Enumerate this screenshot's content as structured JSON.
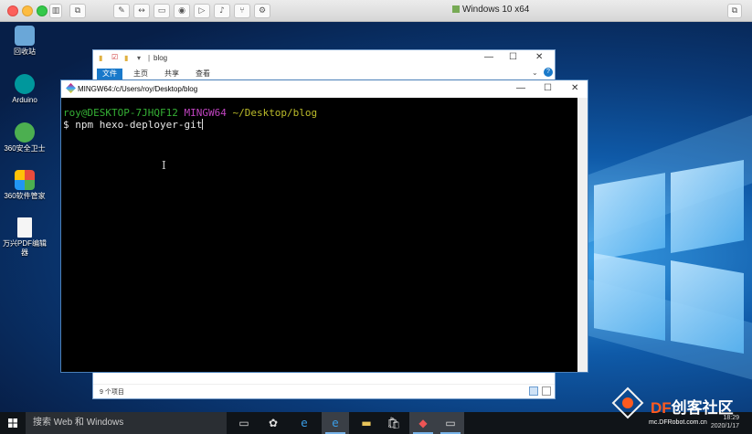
{
  "host": {
    "vm_title": "Windows 10 x64",
    "toolbar_icons": [
      "sidebar-icon",
      "snapshot-icon",
      "wrench-icon",
      "resize-icon",
      "hdd-icon",
      "user-icon",
      "video-icon",
      "sound-icon",
      "usb-icon",
      "gear-icon"
    ]
  },
  "desktop": {
    "icons": [
      {
        "label": "回收站",
        "name": "recycle-bin-icon",
        "color": "#6aa7d8"
      },
      {
        "label": "Arduino",
        "name": "arduino-icon",
        "color": "#00979c"
      },
      {
        "label": "360安全卫士",
        "name": "360-security-icon",
        "color": "#4caf50"
      },
      {
        "label": "360软件管家",
        "name": "360-software-icon",
        "color": "#e94b3c"
      },
      {
        "label": "万兴PDF编辑器",
        "name": "pdf-editor-icon",
        "color": "#f5f5f5"
      }
    ]
  },
  "explorer": {
    "path": "blog",
    "tabs": [
      "文件",
      "主页",
      "共享",
      "查看"
    ],
    "status": "9 个项目",
    "controls": [
      "—",
      "☐",
      "✕"
    ]
  },
  "terminal": {
    "title": "MINGW64:/c/Users/roy/Desktop/blog",
    "user_host": "roy@DESKTOP-7JHQF12",
    "env": "MINGW64",
    "cwd": "~/Desktop/blog",
    "prompt": "$",
    "command": "npm hexo-deployer-git",
    "controls": [
      "—",
      "☐",
      "✕"
    ]
  },
  "taskbar": {
    "search_placeholder": "搜索 Web 和 Windows",
    "time": "18:29",
    "date": "2020/1/17"
  },
  "watermark": {
    "brand_df": "DF",
    "brand_cn": "创客社区",
    "url": "mc.DFRobot.com.cn"
  }
}
